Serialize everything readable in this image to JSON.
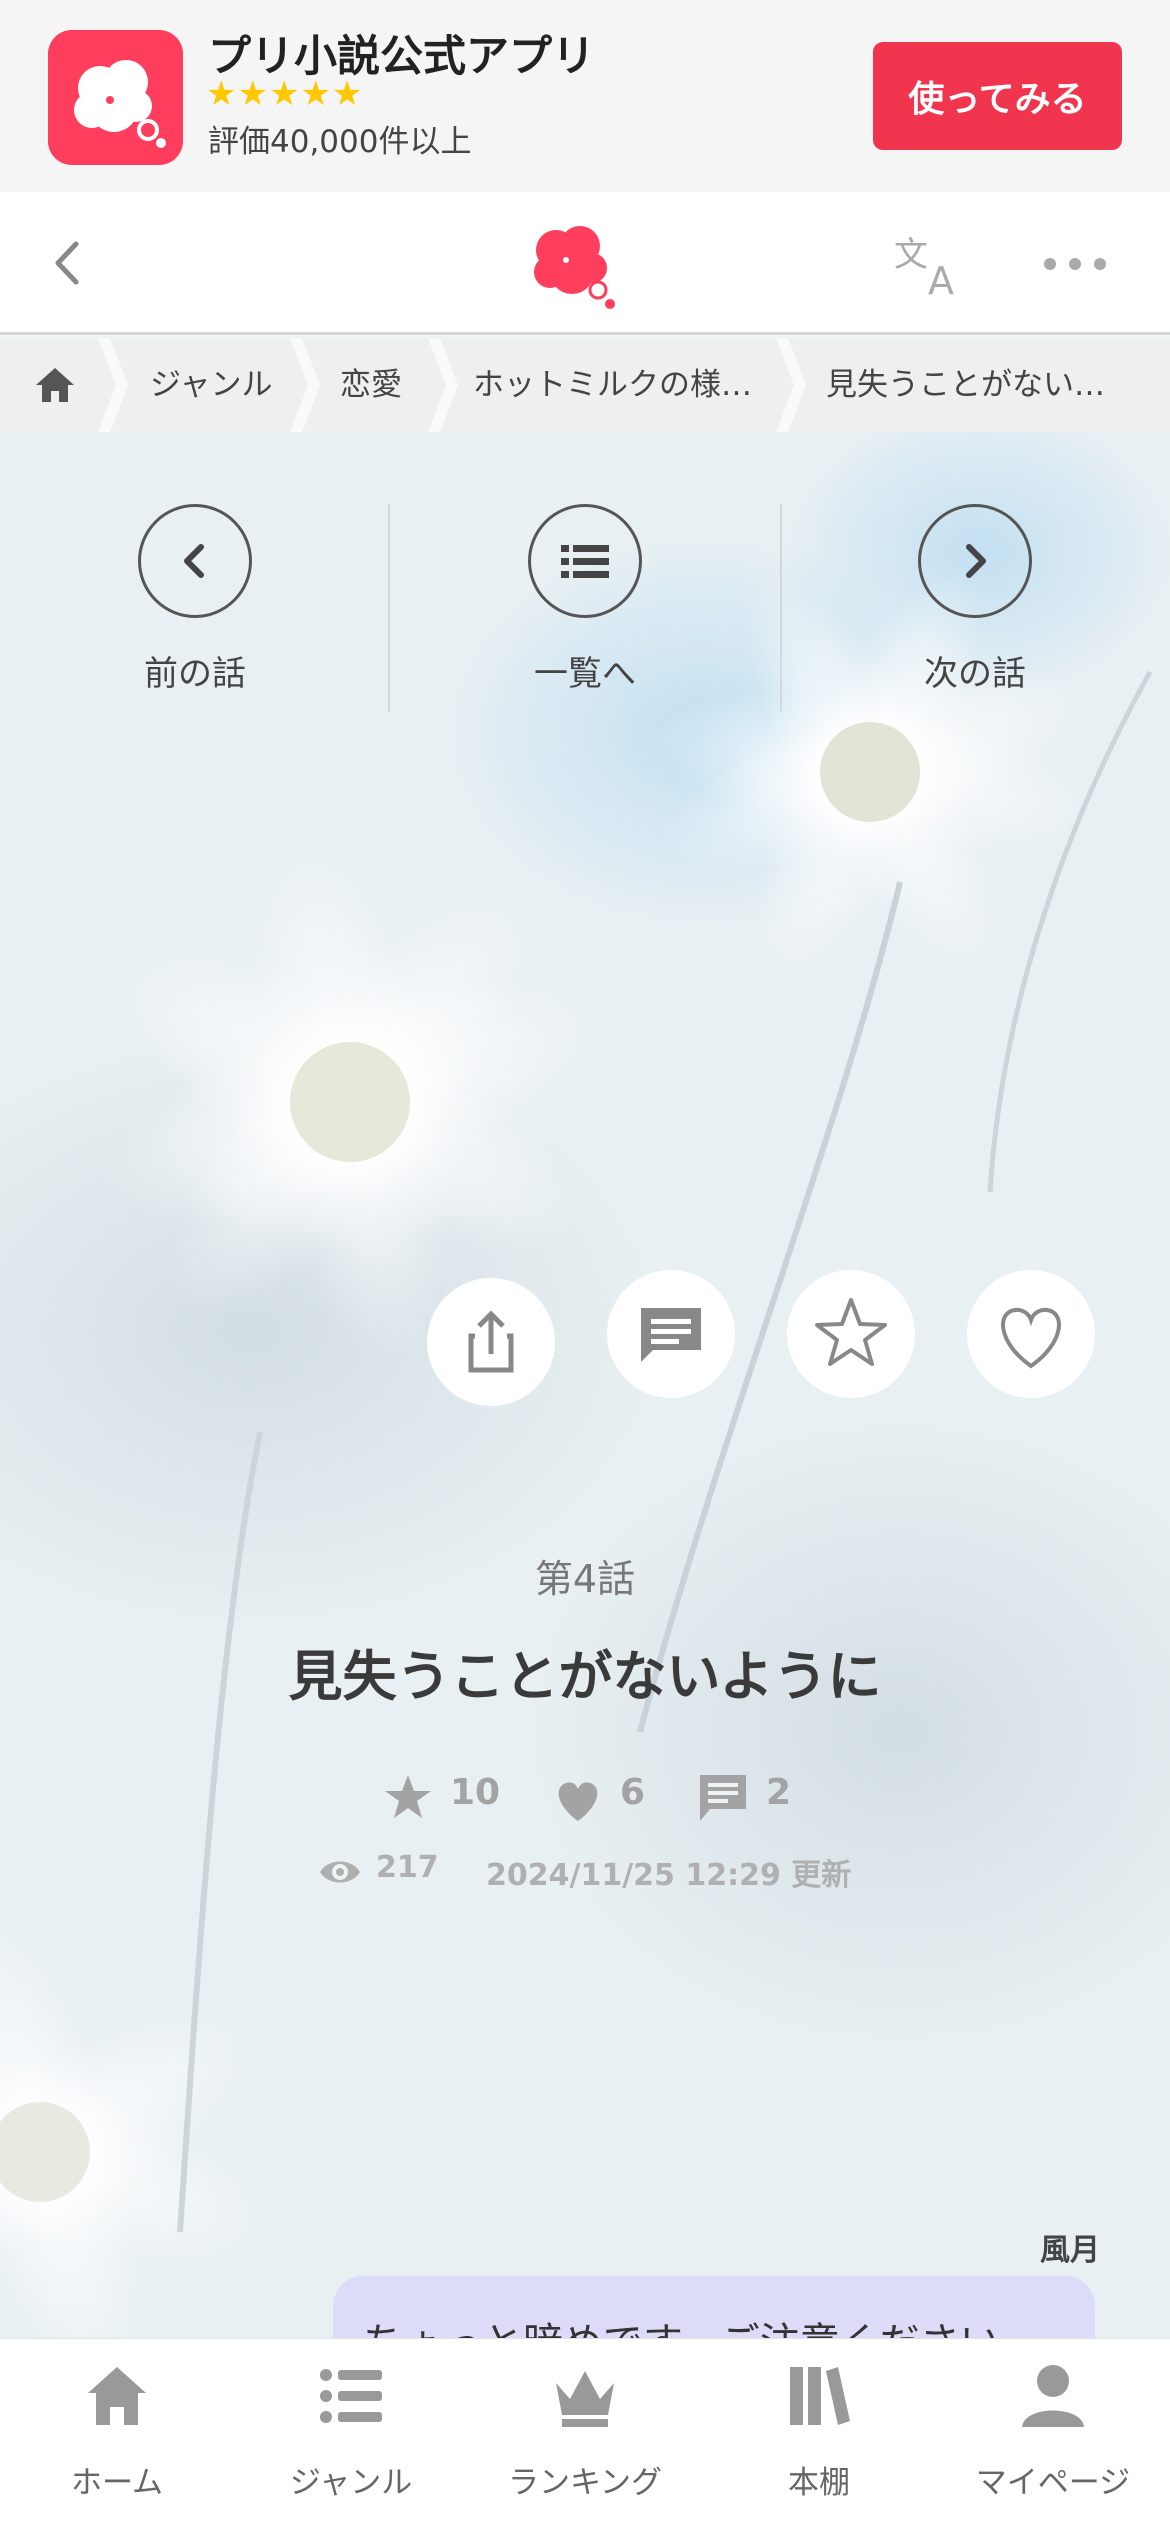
{
  "promo": {
    "app_title": "プリ小説公式アプリ",
    "stars": "★★★★★",
    "rating": "評価40,000件以上",
    "cta_label": "使ってみる"
  },
  "header": {
    "icons": [
      "back-chevron-icon",
      "logo-icon",
      "translate-icon",
      "more-icon"
    ]
  },
  "breadcrumb": {
    "items": [
      "ジャンル",
      "恋愛",
      "ホットミルクの様…",
      "見失うことがない…"
    ]
  },
  "episode_nav": {
    "prev_label": "前の話",
    "list_label": "一覧へ",
    "next_label": "次の話"
  },
  "episode": {
    "number": "第4話",
    "title": "見失うことがないように",
    "stars": "10",
    "likes": "6",
    "comments": "2",
    "views": "217",
    "updated": "2024/11/25 12:29 更新"
  },
  "note": {
    "author": "風月",
    "text": "ちょっと暗めです、ご注意ください"
  },
  "tabbar": {
    "items": [
      {
        "label": "ホーム",
        "icon": "home-icon"
      },
      {
        "label": "ジャンル",
        "icon": "list-icon"
      },
      {
        "label": "ランキング",
        "icon": "crown-icon"
      },
      {
        "label": "本棚",
        "icon": "bookshelf-icon"
      },
      {
        "label": "マイページ",
        "icon": "person-icon"
      }
    ]
  },
  "colors": {
    "brand": "#ff3d5c",
    "cta": "#f2354f",
    "stars": "#ffc800",
    "bubble": "#dcdcf8"
  }
}
